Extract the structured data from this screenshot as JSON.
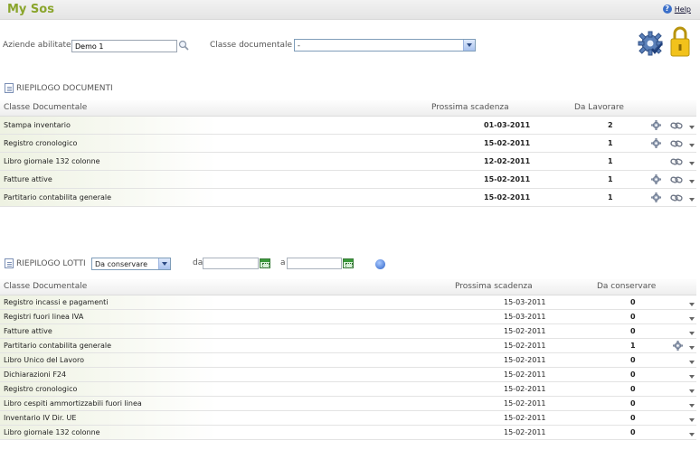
{
  "app": {
    "title": "My Sos",
    "help_label": "Help"
  },
  "filters": {
    "aziende_label": "Aziende abilitate",
    "aziende_value": "Demo 1",
    "classe_label": "Classe documentale",
    "classe_value": "-"
  },
  "documenti": {
    "section_title": "RIEPILOGO DOCUMENTI",
    "columns": [
      "Classe Documentale",
      "Prossima scadenza",
      "Da Lavorare"
    ],
    "rows": [
      {
        "classe": "Stampa inventario",
        "scadenza": "01-03-2011",
        "lavorare": "2",
        "gear": true
      },
      {
        "classe": "Registro cronologico",
        "scadenza": "15-02-2011",
        "lavorare": "1",
        "gear": true
      },
      {
        "classe": "Libro giornale 132 colonne",
        "scadenza": "12-02-2011",
        "lavorare": "1",
        "gear": false
      },
      {
        "classe": "Fatture attive",
        "scadenza": "15-02-2011",
        "lavorare": "1",
        "gear": true
      },
      {
        "classe": "Partitario contabilita generale",
        "scadenza": "15-02-2011",
        "lavorare": "1",
        "gear": true
      }
    ]
  },
  "lotti": {
    "section_title": "RIEPILOGO LOTTI",
    "status_value": "Da conservare",
    "da_label": "da",
    "a_label": "a",
    "columns": [
      "Classe Documentale",
      "Prossima scadenza",
      "Da conservare"
    ],
    "rows": [
      {
        "classe": "Registro incassi e pagamenti",
        "scadenza": "15-03-2011",
        "conservare": "0",
        "gear": false
      },
      {
        "classe": "Registri fuori linea IVA",
        "scadenza": "15-03-2011",
        "conservare": "0",
        "gear": false
      },
      {
        "classe": "Fatture attive",
        "scadenza": "15-02-2011",
        "conservare": "0",
        "gear": false
      },
      {
        "classe": "Partitario contabilita generale",
        "scadenza": "15-02-2011",
        "conservare": "1",
        "gear": true
      },
      {
        "classe": "Libro Unico del Lavoro",
        "scadenza": "15-02-2011",
        "conservare": "0",
        "gear": false
      },
      {
        "classe": "Dichiarazioni F24",
        "scadenza": "15-02-2011",
        "conservare": "0",
        "gear": false
      },
      {
        "classe": "Registro cronologico",
        "scadenza": "15-02-2011",
        "conservare": "0",
        "gear": false
      },
      {
        "classe": "Libro cespiti ammortizzabili fuori linea",
        "scadenza": "15-02-2011",
        "conservare": "0",
        "gear": false
      },
      {
        "classe": "Inventario IV Dir. UE",
        "scadenza": "15-02-2011",
        "conservare": "0",
        "gear": false
      },
      {
        "classe": "Libro giornale 132 colonne",
        "scadenza": "15-02-2011",
        "conservare": "0",
        "gear": false
      }
    ]
  },
  "colors": {
    "title_green": "#8aa52c",
    "help_blue": "#3b6fc9",
    "gear_blue": "#5a7fb8",
    "lock_yellow": "#f2c21b"
  }
}
